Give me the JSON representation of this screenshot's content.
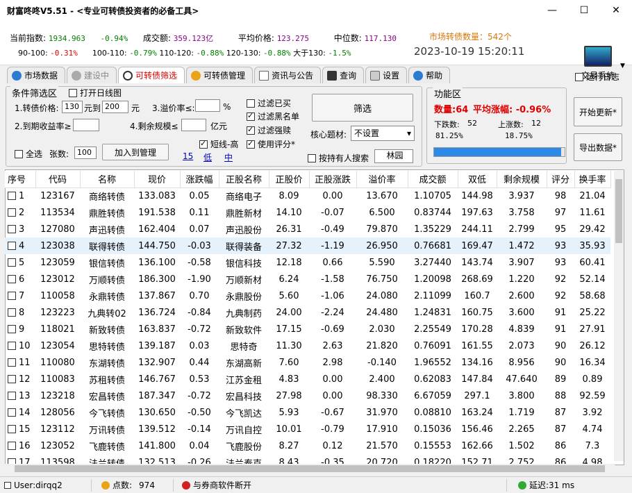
{
  "window": {
    "title": "财富咚咚V5.51 - <专业可转债投资者的必备工具>"
  },
  "info": {
    "idx_label": "当前指数:",
    "idx_val": "1934.963",
    "idx_chg": "-0.94%",
    "amt_label": "成交额:",
    "amt_val": "359.123亿",
    "avg_label": "平均价格:",
    "avg_val": "123.275",
    "med_label": "中位数:",
    "med_val": "117.130",
    "r1_label": "90-100:",
    "r1_val": "-0.31%",
    "r2_label": "100-110:",
    "r2_val": "-0.79%",
    "r3_label": "110-120:",
    "r3_val": "-0.88%",
    "r4_label": "120-130:",
    "r4_val": "-0.88%",
    "r5_label": "大于130:",
    "r5_val": "-1.5%",
    "market_count": "市场转债数量：542个",
    "datetime": "2023-10-19 15:20:11",
    "trade_label": "交易系统"
  },
  "tabs": [
    "市场数据",
    "建设中",
    "可转债筛选",
    "可转债管理",
    "资讯与公告",
    "查询",
    "设置",
    "帮助"
  ],
  "runlog_label": "运行日志",
  "filter": {
    "title": "条件筛选区",
    "daily_line": "打开日线图",
    "price_label": "1.转债价格:",
    "price_min": "130",
    "price_to": "元到",
    "price_max": "200",
    "price_unit": "元",
    "premium_label": "3.溢价率≤:",
    "premium_unit": "%",
    "ytm_label": "2.到期收益率≥",
    "remain_label": "4.剩余规模≤",
    "remain_unit": "亿元",
    "cb_redeemed": "过滤已买",
    "cb_blacklist": "过滤黑名单",
    "cb_strong": "过滤强赎",
    "cb_short": "短线-高",
    "cb_score": "使用评分*",
    "select_all": "全选",
    "count_label": "张数:",
    "count_val": "100",
    "add_btn": "加入到管理",
    "link15": "15",
    "link_low": "低",
    "link_mid": "中",
    "filter_btn": "筛选",
    "theme_label": "核心题材:",
    "theme_val": "不设置",
    "holder_label": "按持有人搜索",
    "holder_val": "林园"
  },
  "func": {
    "title": "功能区",
    "count": "数量:64",
    "avg": "平均涨幅: -0.96%",
    "down_label": "下跌数:",
    "down_val": "52",
    "up_label": "上涨数:",
    "up_val": "12",
    "down_pct": "81.25%",
    "up_pct": "18.75%",
    "progress": 0.975,
    "start_btn": "开始更新*",
    "export_btn": "导出数据*"
  },
  "table": {
    "headers": [
      "序号",
      "代码",
      "名称",
      "现价",
      "涨跌幅",
      "正股名称",
      "正股价",
      "正股涨跌",
      "溢价率",
      "成交额",
      "双低",
      "剩余规模",
      "评分",
      "换手率"
    ],
    "rows": [
      [
        "1",
        "123167",
        "商络转债",
        "133.083",
        "0.05",
        "商络电子",
        "8.09",
        "0.00",
        "13.670",
        "1.10705",
        "144.98",
        "3.937",
        "98",
        "21.04"
      ],
      [
        "2",
        "113534",
        "鼎胜转债",
        "191.538",
        "0.11",
        "鼎胜新材",
        "14.10",
        "-0.07",
        "6.500",
        "0.83744",
        "197.63",
        "3.758",
        "97",
        "11.61"
      ],
      [
        "3",
        "127080",
        "声迅转债",
        "162.404",
        "0.07",
        "声迅股份",
        "26.31",
        "-0.49",
        "79.870",
        "1.35229",
        "244.11",
        "2.799",
        "95",
        "29.42"
      ],
      [
        "4",
        "123038",
        "联得转债",
        "144.750",
        "-0.03",
        "联得装备",
        "27.32",
        "-1.19",
        "26.950",
        "0.76681",
        "169.47",
        "1.472",
        "93",
        "35.93"
      ],
      [
        "5",
        "123059",
        "银信转债",
        "136.100",
        "-0.58",
        "银信科技",
        "12.18",
        "0.66",
        "5.590",
        "3.27440",
        "143.74",
        "3.907",
        "93",
        "60.41"
      ],
      [
        "6",
        "123012",
        "万顺转债",
        "186.300",
        "-1.90",
        "万顺新材",
        "6.24",
        "-1.58",
        "76.750",
        "1.20098",
        "268.69",
        "1.220",
        "92",
        "52.14"
      ],
      [
        "7",
        "110058",
        "永鼎转债",
        "137.867",
        "0.70",
        "永鼎股份",
        "5.60",
        "-1.06",
        "24.080",
        "2.11099",
        "160.7",
        "2.600",
        "92",
        "58.68"
      ],
      [
        "8",
        "123223",
        "九典转02",
        "136.724",
        "-0.84",
        "九典制药",
        "24.00",
        "-2.24",
        "24.480",
        "1.24831",
        "160.75",
        "3.600",
        "91",
        "25.22"
      ],
      [
        "9",
        "118021",
        "新致转债",
        "163.837",
        "-0.72",
        "新致软件",
        "17.15",
        "-0.69",
        "2.030",
        "2.25549",
        "170.28",
        "4.839",
        "91",
        "27.91"
      ],
      [
        "10",
        "123054",
        "思特转债",
        "139.187",
        "0.03",
        "思特奇",
        "11.30",
        "2.63",
        "21.820",
        "0.76091",
        "161.55",
        "2.073",
        "90",
        "26.12"
      ],
      [
        "11",
        "110080",
        "东湖转债",
        "132.907",
        "0.44",
        "东湖高新",
        "7.60",
        "2.98",
        "-0.140",
        "1.96552",
        "134.16",
        "8.956",
        "90",
        "16.34"
      ],
      [
        "12",
        "110083",
        "苏租转债",
        "146.767",
        "0.53",
        "江苏金租",
        "4.83",
        "0.00",
        "2.400",
        "0.62083",
        "147.84",
        "47.640",
        "89",
        "0.89"
      ],
      [
        "13",
        "123218",
        "宏昌转债",
        "187.347",
        "-0.72",
        "宏昌科技",
        "27.98",
        "0.00",
        "98.330",
        "6.67059",
        "297.1",
        "3.800",
        "88",
        "92.59"
      ],
      [
        "14",
        "128056",
        "今飞转债",
        "130.650",
        "-0.50",
        "今飞凯达",
        "5.93",
        "-0.67",
        "31.970",
        "0.08810",
        "163.24",
        "1.719",
        "87",
        "3.92"
      ],
      [
        "15",
        "123112",
        "万讯转债",
        "139.512",
        "-0.14",
        "万讯自控",
        "10.01",
        "-0.79",
        "17.910",
        "0.15036",
        "156.46",
        "2.265",
        "87",
        "4.74"
      ],
      [
        "16",
        "123052",
        "飞鹿转债",
        "141.800",
        "0.04",
        "飞鹿股份",
        "8.27",
        "0.12",
        "21.570",
        "0.15553",
        "162.66",
        "1.502",
        "86",
        "7.3"
      ],
      [
        "17",
        "113598",
        "法兰转债",
        "132.513",
        "-0.26",
        "法兰泰克",
        "8.43",
        "-0.35",
        "20.720",
        "0.18220",
        "152.71",
        "2.752",
        "86",
        "4.98"
      ]
    ]
  },
  "status": {
    "user": "User:dirqq2",
    "points_label": "点数:",
    "points_val": "974",
    "broker": "与券商软件断开",
    "latency": "延迟:31 ms"
  }
}
